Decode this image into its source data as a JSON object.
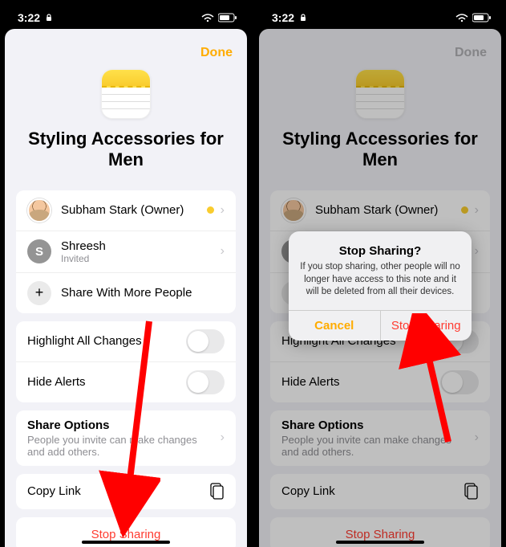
{
  "statusbar": {
    "time": "3:22"
  },
  "done_label": "Done",
  "note_title": "Styling Accessories for Men",
  "people": {
    "owner": {
      "name": "Subham Stark (Owner)"
    },
    "invitee": {
      "initial": "S",
      "name": "Shreesh",
      "status": "Invited"
    },
    "share_more": "Share With More People"
  },
  "settings": {
    "highlight": "Highlight All Changes",
    "hide_alerts": "Hide Alerts"
  },
  "share_options": {
    "heading": "Share Options",
    "desc": "People you invite can make changes and add others."
  },
  "copy_link": "Copy Link",
  "stop_sharing": "Stop Sharing",
  "alert": {
    "title": "Stop Sharing?",
    "message": "If you stop sharing, other people will no longer have access to this note and it will be deleted from all their devices.",
    "cancel": "Cancel",
    "confirm": "Stop Sharing"
  }
}
